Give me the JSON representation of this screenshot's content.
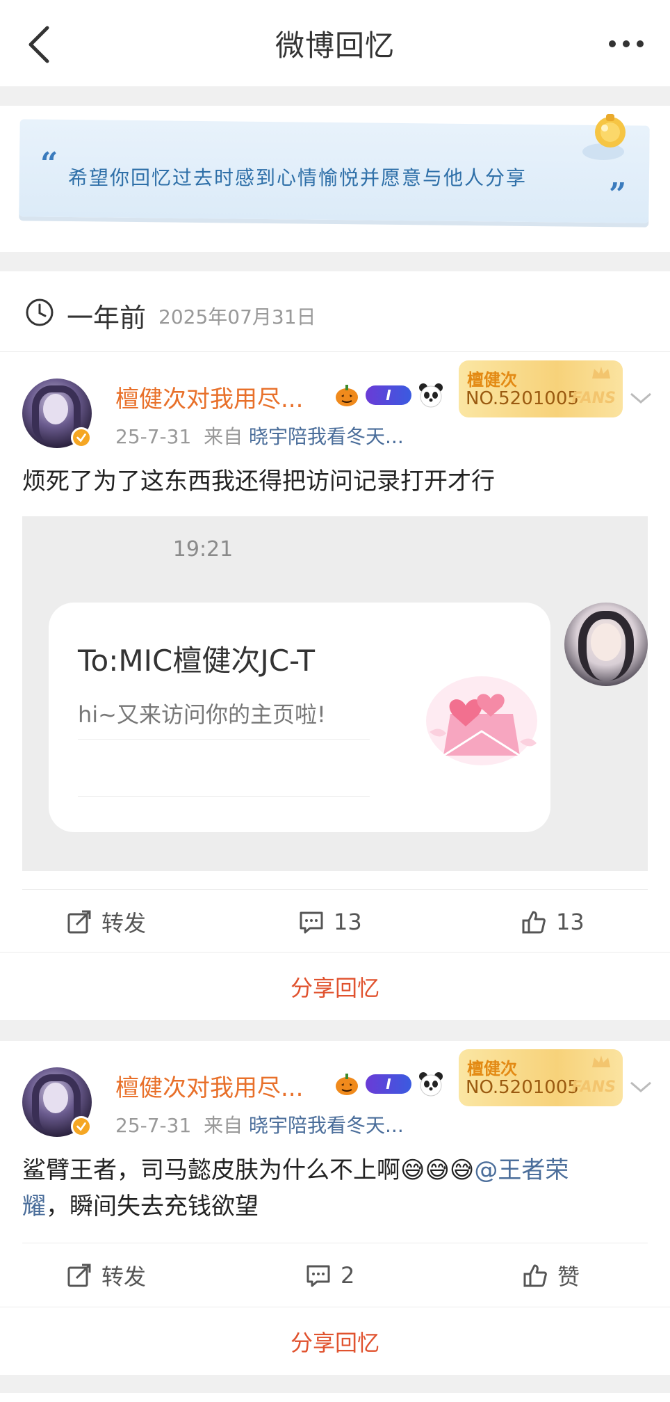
{
  "header": {
    "title": "微博回忆"
  },
  "quote": {
    "open": "“",
    "text": "希望你回忆过去时感到心情愉悦并愿意与他人分享",
    "close": "”"
  },
  "date_header": {
    "relative": "一年前",
    "date": "2025年07月31日"
  },
  "posts": [
    {
      "username": "檀健次对我用尽...",
      "level_badge": "I",
      "fans_card": {
        "name": "檀健次",
        "number": "NO.5201005",
        "tag": "FANS"
      },
      "time": "25-7-31",
      "from_label": "来自",
      "source": "晓宇陪我看冬天...",
      "content": "烦死了为了这东西我还得把访问记录打开才行",
      "image": {
        "time": "19:21",
        "to": "To:MIC檀健次JC-T",
        "body": "hi~又来访问你的主页啦!"
      },
      "repost_label": "转发",
      "comments": "13",
      "likes": "13",
      "share_label": "分享回忆"
    },
    {
      "username": "檀健次对我用尽...",
      "level_badge": "I",
      "fans_card": {
        "name": "檀健次",
        "number": "NO.5201005",
        "tag": "FANS"
      },
      "time": "25-7-31",
      "from_label": "来自",
      "source": "晓宇陪我看冬天...",
      "content_part1": "鲨臂王者，司马懿皮肤为什么不上啊😅😅😅",
      "mention_part1": "@王者荣",
      "mention_part2": "耀",
      "content_part2": "，瞬间失去充钱欲望",
      "repost_label": "转发",
      "comments": "2",
      "likes": "赞",
      "share_label": "分享回忆"
    }
  ],
  "icons": [
    "back-icon",
    "more-icon",
    "bell-icon",
    "clock-icon",
    "verified-icon",
    "pumpkin-icon",
    "panda-icon",
    "crown-icon",
    "chevron-down-icon",
    "repost-icon",
    "comment-icon",
    "like-icon",
    "envelope-hearts-icon"
  ],
  "colors": {
    "accent_orange": "#e8702a",
    "link_blue": "#4a6d9a",
    "share_red": "#e0522e",
    "quote_blue": "#2e6fa8"
  }
}
